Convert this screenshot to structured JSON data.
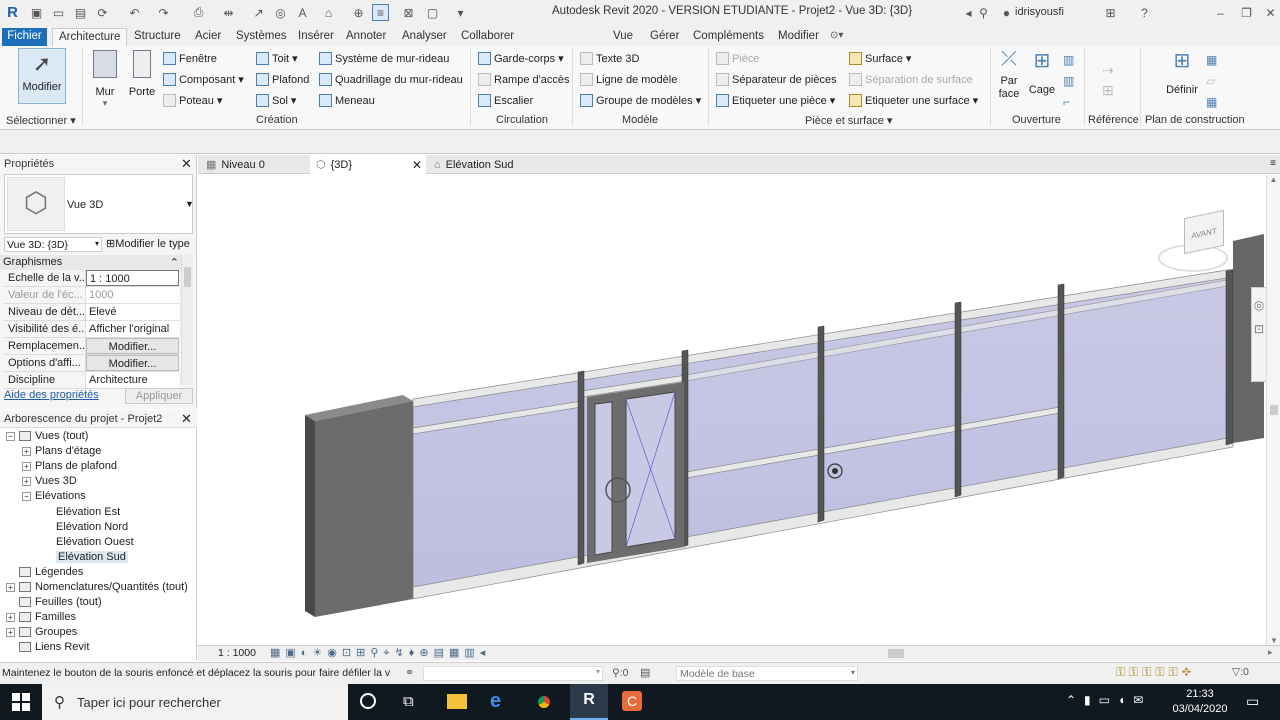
{
  "titlebar": {
    "title": "Autodesk Revit 2020 - VERSION ETUDIANTE - Projet2 - Vue 3D: {3D}",
    "user": "idrisyousfi"
  },
  "tabs": [
    "Fichier",
    "Architecture",
    "Structure",
    "Acier",
    "Systèmes",
    "Insérer",
    "Annoter",
    "Analyser",
    "Collaborer",
    "Vue",
    "Gérer",
    "Compléments",
    "Modifier"
  ],
  "ribbon": {
    "modify": "Modifier",
    "wall": "Mur",
    "door": "Porte",
    "window": "Fenêtre",
    "component": "Composant",
    "column": "Poteau",
    "roof": "Toit",
    "ceiling": "Plafond",
    "floor": "Sol",
    "curtain_system": "Système de mur-rideau",
    "curtain_grid": "Quadrillage du mur-rideau",
    "mullion": "Meneau",
    "railing": "Garde-corps",
    "ramp": "Rampe d'accès",
    "stair": "Escalier",
    "model_text": "Texte 3D",
    "model_line": "Ligne de modèle",
    "model_group": "Groupe de modèles",
    "room": "Pièce",
    "room_separator": "Séparateur  de pièces",
    "tag_room": "Etiqueter  une pièce",
    "area": "Surface",
    "area_boundary": "Séparation  de surface",
    "tag_area": "Etiqueter  une surface",
    "by_face": "Par face",
    "shaft": "Cage",
    "set": "Définir",
    "groups": {
      "select": "Sélectionner",
      "build": "Création",
      "circulation": "Circulation",
      "model": "Modèle",
      "room_area": "Pièce et surface",
      "opening": "Ouverture",
      "datum": "Référence",
      "work_plane": "Plan de construction"
    }
  },
  "properties": {
    "title": "Propriétés",
    "type_name": "Vue 3D",
    "selector": "Vue 3D: {3D}",
    "edit_type": "Modifier le type",
    "section": "Graphismes",
    "rows": [
      {
        "k": "Echelle de la v...",
        "v": "1 : 1000"
      },
      {
        "k": "Valeur de l'éc...",
        "v": "1000"
      },
      {
        "k": "Niveau de dét...",
        "v": "Elevé"
      },
      {
        "k": "Visibilité des é...",
        "v": "Afficher l'original"
      },
      {
        "k": "Remplacemen...",
        "v": "Modifier..."
      },
      {
        "k": "Options d'affi...",
        "v": "Modifier..."
      },
      {
        "k": "Discipline",
        "v": "Architecture"
      }
    ],
    "help": "Aide des propriétés",
    "apply": "Appliquer"
  },
  "browser": {
    "title": "Arborescence du projet - Projet2",
    "items": [
      "Vues (tout)",
      "Plans d'étage",
      "Plans de plafond",
      "Vues 3D",
      "Elévations",
      "Elévation Est",
      "Elévation Nord",
      "Elévation Ouest",
      "Elévation Sud",
      "Légendes",
      "Nomenclatures/Quantités (tout)",
      "Feuilles (tout)",
      "Familles",
      "Groupes",
      "Liens Revit"
    ]
  },
  "viewtabs": [
    "Niveau 0",
    "{3D}",
    "Elévation Sud"
  ],
  "viewcube": "AVANT",
  "viewcontrol": {
    "scale": "1 : 1000"
  },
  "status": {
    "message": "Maintenez le bouton de la souris enfoncé et déplacez la souris pour faire défiler la v",
    "workset_count": ":0",
    "model": "Modèle de base",
    "filter": ":0"
  },
  "taskbar": {
    "search": "Taper ici pour rechercher",
    "time": "21:33",
    "date": "03/04/2020"
  }
}
